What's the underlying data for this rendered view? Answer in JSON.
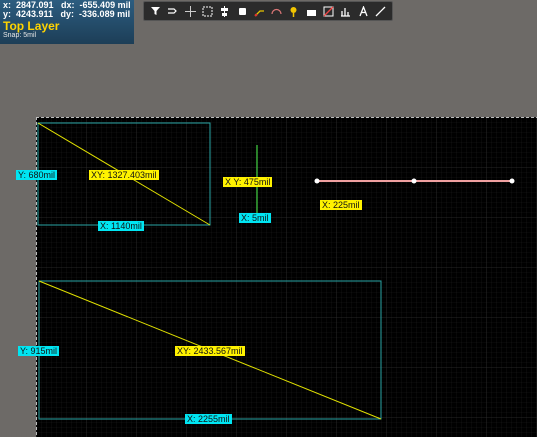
{
  "hud": {
    "line1": "x:  2847.091   dx:  -655.409 mil",
    "line2": "y:  4243.911   dy:  -336.089 mil",
    "layer": "Top Layer",
    "snap": "Snap: 5mil"
  },
  "toolbar": {
    "tools": [
      "filter-icon",
      "route-icon",
      "crosshair-icon",
      "select-rect-icon",
      "align-icon",
      "component-icon",
      "interactive-route-icon",
      "arc-icon",
      "pin-icon",
      "fill-icon",
      "polygon-icon",
      "chart-icon",
      "text-icon",
      "line-icon"
    ]
  },
  "measurements": {
    "r1_y": "Y: 680mil",
    "r1_xy": "XY: 1327.403mil",
    "r1_x": "X: 1140mil",
    "cross_xy": "X Y: 475mil",
    "cross_x": "X: 5mil",
    "line_x": "X: 225mil",
    "r2_y": "Y: 915mil",
    "r2_xy": "XY: 2433.567mil",
    "r2_x": "X: 2255mil"
  },
  "colors": {
    "board": "#000000",
    "outside": "#6d6a67",
    "rect": "#2aa6a6",
    "diagonal": "#e0e000",
    "track": "#f0a0a0",
    "cross": "#3fcf3f"
  }
}
